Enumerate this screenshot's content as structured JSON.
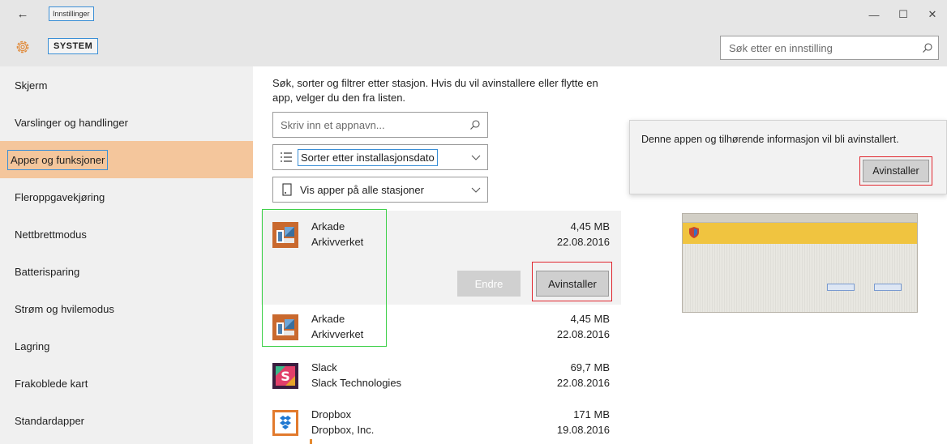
{
  "window": {
    "title": "Innstillinger",
    "minimize": "—",
    "maximize": "☐",
    "close": "✕"
  },
  "header": {
    "section_title": "SYSTEM",
    "search_placeholder": "Søk etter en innstilling"
  },
  "sidebar": {
    "items": [
      {
        "label": "Skjerm"
      },
      {
        "label": "Varslinger og handlinger"
      },
      {
        "label": "Apper og funksjoner",
        "selected": true
      },
      {
        "label": "Fleroppgavekjøring"
      },
      {
        "label": "Nettbrettmodus"
      },
      {
        "label": "Batterisparing"
      },
      {
        "label": "Strøm og hvilemodus"
      },
      {
        "label": "Lagring"
      },
      {
        "label": "Frakoblede kart"
      },
      {
        "label": "Standardapper"
      }
    ]
  },
  "main": {
    "description": "Søk, sorter og filtrer etter stasjon. Hvis du vil avinstallere eller flytte en app, velger du den fra listen.",
    "filter_placeholder": "Skriv inn et appnavn...",
    "sort_label": "Sorter etter installasjonsdato",
    "drive_label": "Vis apper på alle stasjoner",
    "modify_button": "Endre",
    "uninstall_button": "Avinstaller",
    "apps": [
      {
        "name": "Arkade",
        "publisher": "Arkivverket",
        "size": "4,45 MB",
        "date": "22.08.2016"
      },
      {
        "name": "Arkade",
        "publisher": "Arkivverket",
        "size": "4,45 MB",
        "date": "22.08.2016"
      },
      {
        "name": "Slack",
        "publisher": "Slack Technologies",
        "size": "69,7 MB",
        "date": "22.08.2016"
      },
      {
        "name": "Dropbox",
        "publisher": "Dropbox, Inc.",
        "size": "171 MB",
        "date": "19.08.2016"
      }
    ]
  },
  "flyout": {
    "message": "Denne appen og tilhørende informasjon vil bli avinstallert.",
    "button": "Avinstaller"
  },
  "colors": {
    "selected_nav": "#f4c69c",
    "highlight_red": "#e0262e",
    "highlight_green": "#3fd04a",
    "focus_blue": "#3b8fd6"
  }
}
